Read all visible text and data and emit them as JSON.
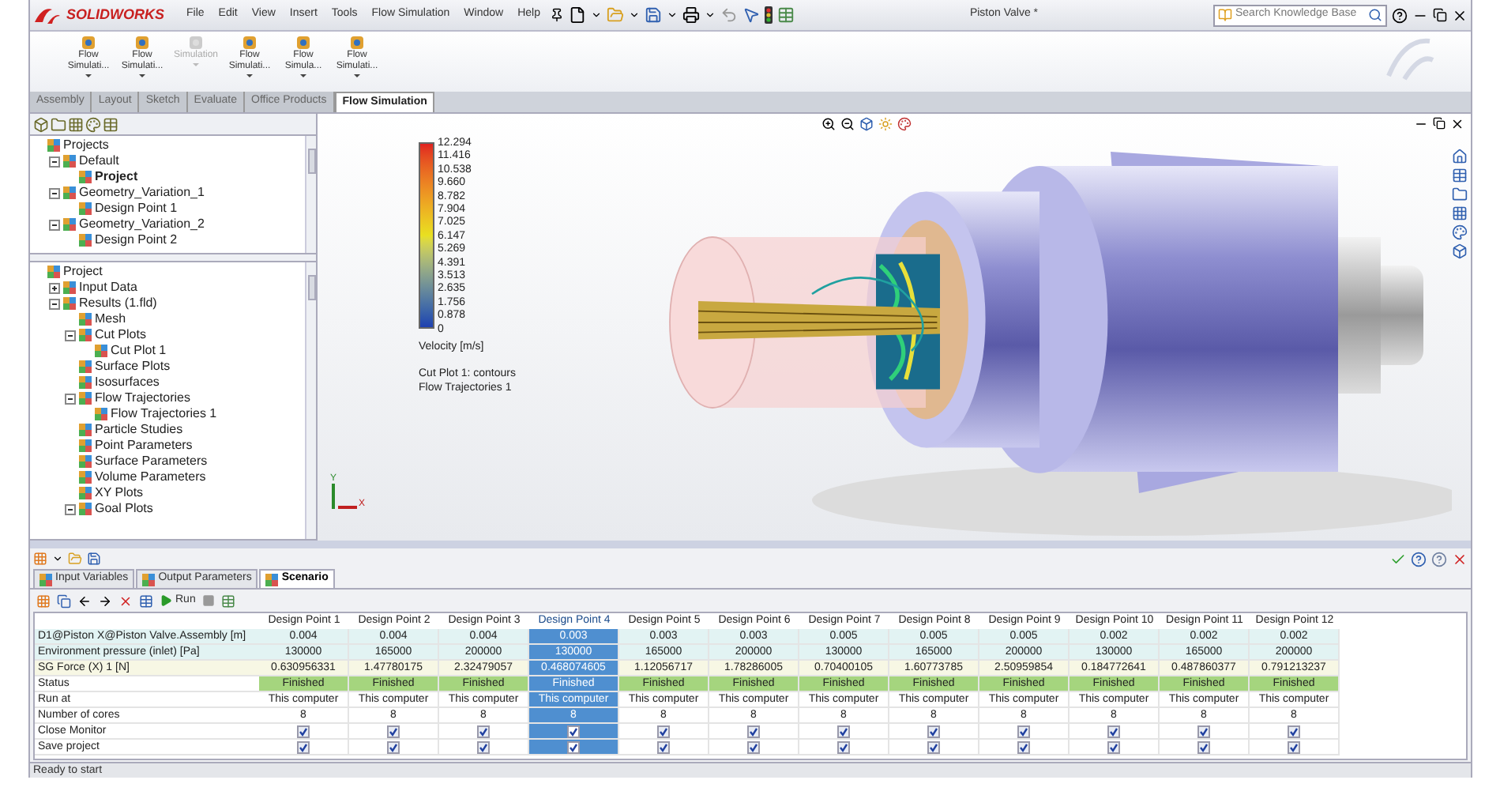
{
  "app": {
    "logo": "SOLIDWORKS",
    "menu": [
      "File",
      "Edit",
      "View",
      "Insert",
      "Tools",
      "Flow Simulation",
      "Window",
      "Help"
    ],
    "title": "Piston Valve *",
    "search": {
      "placeholder": "Search Knowledge Base"
    }
  },
  "ribbon": {
    "buttons": [
      {
        "lines": [
          "Flow",
          "Simulati..."
        ],
        "disabled": false
      },
      {
        "lines": [
          "Flow",
          "Simulati..."
        ],
        "disabled": false
      },
      {
        "lines": [
          "Simulation"
        ],
        "disabled": true
      },
      {
        "lines": [
          "Flow",
          "Simulati..."
        ],
        "disabled": false
      },
      {
        "lines": [
          "Flow",
          "Simula..."
        ],
        "disabled": false
      },
      {
        "lines": [
          "Flow",
          "Simulati..."
        ],
        "disabled": false
      }
    ],
    "tabs": [
      {
        "label": "Assembly",
        "selected": false
      },
      {
        "label": "Layout",
        "selected": false
      },
      {
        "label": "Sketch",
        "selected": false
      },
      {
        "label": "Evaluate",
        "selected": false
      },
      {
        "label": "Office Products",
        "selected": false
      },
      {
        "label": "Flow Simulation",
        "selected": true
      }
    ]
  },
  "projects_tree": [
    {
      "label": "Projects",
      "children": [
        {
          "label": "Default",
          "expanded": true,
          "children": [
            {
              "label": "Project",
              "active": true
            }
          ]
        },
        {
          "label": "Geometry_Variation_1",
          "expanded": true,
          "children": [
            {
              "label": "Design Point 1",
              "active": false
            }
          ]
        },
        {
          "label": "Geometry_Variation_2",
          "expanded": true,
          "children": [
            {
              "label": "Design Point 2",
              "active": false
            }
          ]
        }
      ]
    }
  ],
  "analysis_tree": [
    {
      "label": "Project",
      "children": [
        {
          "label": "Input Data",
          "expanded": false
        },
        {
          "label": "Results (1.fld)",
          "expanded": true,
          "children": [
            {
              "label": "Mesh"
            },
            {
              "label": "Cut Plots",
              "expanded": true,
              "children": [
                {
                  "label": "Cut Plot 1"
                }
              ]
            },
            {
              "label": "Surface Plots"
            },
            {
              "label": "Isosurfaces"
            },
            {
              "label": "Flow Trajectories",
              "expanded": true,
              "children": [
                {
                  "label": "Flow Trajectories 1"
                }
              ]
            },
            {
              "label": "Particle Studies"
            },
            {
              "label": "Point Parameters"
            },
            {
              "label": "Surface Parameters"
            },
            {
              "label": "Volume Parameters"
            },
            {
              "label": "XY Plots"
            },
            {
              "label": "Goal Plots",
              "expanded": true
            }
          ]
        }
      ]
    }
  ],
  "viewport": {
    "legend": {
      "ticks": [
        "12.294",
        "11.416",
        "10.538",
        "9.660",
        "8.782",
        "7.904",
        "7.025",
        "6.147",
        "5.269",
        "4.391",
        "3.513",
        "2.635",
        "1.756",
        "0.878",
        "0"
      ],
      "title": "Velocity [m/s]"
    },
    "captions": [
      "Cut Plot 1: contours",
      "Flow Trajectories 1"
    ],
    "axes": [
      "Y",
      "X"
    ]
  },
  "parameters": {
    "tabs": [
      {
        "label": "Input Variables",
        "selected": false
      },
      {
        "label": "Output Parameters",
        "selected": false
      },
      {
        "label": "Scenario",
        "selected": true
      }
    ],
    "run_label": "Run",
    "table": {
      "rows": [
        {
          "label": "D1@Piston X@Piston Valve.Assembly [m]",
          "kind": "input"
        },
        {
          "label": "Environment pressure (inlet) [Pa]",
          "kind": "input"
        },
        {
          "label": "SG Force (X) 1 [N]",
          "kind": "output"
        },
        {
          "label": "Status",
          "kind": "status"
        },
        {
          "label": "Run at",
          "kind": "text"
        },
        {
          "label": "Number of cores",
          "kind": "text"
        },
        {
          "label": "Close Monitor",
          "kind": "check"
        },
        {
          "label": "Save project",
          "kind": "check"
        }
      ],
      "columns": [
        {
          "header": "Design Point 1",
          "selected": false,
          "cells": [
            "0.004",
            "130000",
            "0.630956331",
            "Finished",
            "This computer",
            "8",
            {
              "checked": true
            },
            {
              "checked": true
            }
          ]
        },
        {
          "header": "Design Point 2",
          "selected": false,
          "cells": [
            "0.004",
            "165000",
            "1.47780175",
            "Finished",
            "This computer",
            "8",
            {
              "checked": true
            },
            {
              "checked": true
            }
          ]
        },
        {
          "header": "Design Point 3",
          "selected": false,
          "cells": [
            "0.004",
            "200000",
            "2.32479057",
            "Finished",
            "This computer",
            "8",
            {
              "checked": true
            },
            {
              "checked": true
            }
          ]
        },
        {
          "header": "Design Point 4",
          "selected": true,
          "cells": [
            "0.003",
            "130000",
            "0.468074605",
            "Finished",
            "This computer",
            "8",
            {
              "checked": true
            },
            {
              "checked": true
            }
          ]
        },
        {
          "header": "Design Point 5",
          "selected": false,
          "cells": [
            "0.003",
            "165000",
            "1.12056717",
            "Finished",
            "This computer",
            "8",
            {
              "checked": true
            },
            {
              "checked": true
            }
          ]
        },
        {
          "header": "Design Point 6",
          "selected": false,
          "cells": [
            "0.003",
            "200000",
            "1.78286005",
            "Finished",
            "This computer",
            "8",
            {
              "checked": true
            },
            {
              "checked": true
            }
          ]
        },
        {
          "header": "Design Point 7",
          "selected": false,
          "cells": [
            "0.005",
            "130000",
            "0.70400105",
            "Finished",
            "This computer",
            "8",
            {
              "checked": true
            },
            {
              "checked": true
            }
          ]
        },
        {
          "header": "Design Point 8",
          "selected": false,
          "cells": [
            "0.005",
            "165000",
            "1.60773785",
            "Finished",
            "This computer",
            "8",
            {
              "checked": true
            },
            {
              "checked": true
            }
          ]
        },
        {
          "header": "Design Point 9",
          "selected": false,
          "cells": [
            "0.005",
            "200000",
            "2.50959854",
            "Finished",
            "This computer",
            "8",
            {
              "checked": true
            },
            {
              "checked": true
            }
          ]
        },
        {
          "header": "Design Point 10",
          "selected": false,
          "cells": [
            "0.002",
            "130000",
            "0.184772641",
            "Finished",
            "This computer",
            "8",
            {
              "checked": true
            },
            {
              "checked": true
            }
          ]
        },
        {
          "header": "Design Point 11",
          "selected": false,
          "cells": [
            "0.002",
            "165000",
            "0.487860377",
            "Finished",
            "This computer",
            "8",
            {
              "checked": true
            },
            {
              "checked": true
            }
          ]
        },
        {
          "header": "Design Point 12",
          "selected": false,
          "cells": [
            "0.002",
            "200000",
            "0.791213237",
            "Finished",
            "This computer",
            "8",
            {
              "checked": true
            },
            {
              "checked": true
            }
          ]
        }
      ]
    },
    "status_bar": "Ready to start"
  }
}
